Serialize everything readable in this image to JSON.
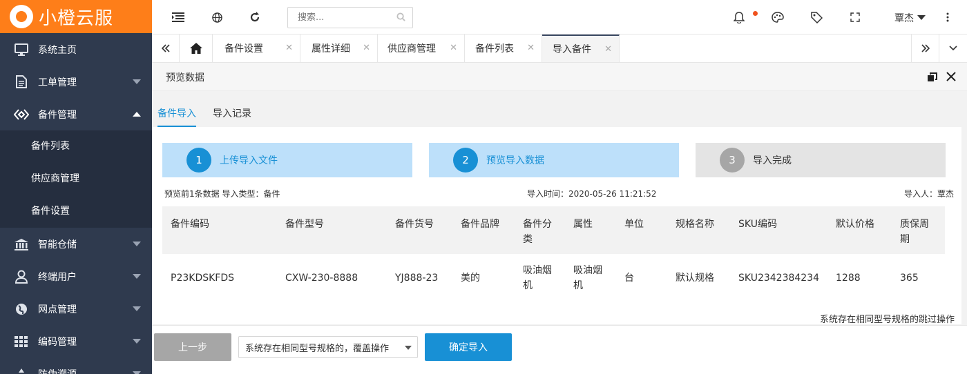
{
  "app": {
    "name": "小橙云服"
  },
  "sidebar": {
    "items": [
      {
        "label": "系统主页",
        "icon": "monitor-icon"
      },
      {
        "label": "工单管理",
        "icon": "document-icon"
      },
      {
        "label": "备件管理",
        "icon": "diamond-icon",
        "expanded": true
      },
      {
        "label": "智能仓储",
        "icon": "warehouse-icon"
      },
      {
        "label": "终端用户",
        "icon": "user-icon"
      },
      {
        "label": "网点管理",
        "icon": "globe-icon"
      },
      {
        "label": "编码管理",
        "icon": "grid-icon"
      },
      {
        "label": "防伪溯源",
        "icon": "recycle-icon"
      }
    ],
    "submenu": [
      "备件列表",
      "供应商管理",
      "备件设置"
    ]
  },
  "topbar": {
    "search_placeholder": "搜索...",
    "user": "覃杰",
    "icons": [
      "menu-toggle-icon",
      "globe-icon",
      "refresh-icon",
      "search-icon",
      "bell-icon",
      "palette-icon",
      "tag-icon",
      "fullscreen-icon",
      "more-icon"
    ]
  },
  "tabs": [
    "备件设置",
    "属性详细",
    "供应商管理",
    "备件列表",
    "导入备件"
  ],
  "breadcrumb": "预览数据",
  "subtabs": [
    "备件导入",
    "导入记录"
  ],
  "steps": [
    {
      "num": "1",
      "label": "上传导入文件",
      "state": "done"
    },
    {
      "num": "2",
      "label": "预览导入数据",
      "state": "active"
    },
    {
      "num": "3",
      "label": "导入完成",
      "state": "pending"
    }
  ],
  "meta": {
    "left": "预览前1条数据 导入类型：备件",
    "middle": "导入时间：2020-05-26 11:21:52",
    "right": "导入人：覃杰"
  },
  "table": {
    "columns": [
      "备件编码",
      "备件型号",
      "备件货号",
      "备件品牌",
      "备件分类",
      "属性",
      "单位",
      "规格名称",
      "SKU编码",
      "默认价格",
      "质保周期"
    ],
    "rows": [
      [
        "P23KDSKFDS",
        "CXW-230-8888",
        "YJ888-23",
        "美的",
        "吸油烟机",
        "吸油烟机",
        "台",
        "默认规格",
        "SKU2342384234",
        "1288",
        "365"
      ]
    ]
  },
  "note": "系统存在相同型号规格的跳过操作",
  "footer": {
    "prev_button": "上一步",
    "select_value": "系统存在相同型号规格的，覆盖操作",
    "confirm_button": "确定导入"
  },
  "colors": {
    "sidebar": "#2f3a4e",
    "logo": "#fe7e19",
    "primary": "#1890d5",
    "step_active": "#bde0fa",
    "step_pending": "#e4e4e4"
  }
}
